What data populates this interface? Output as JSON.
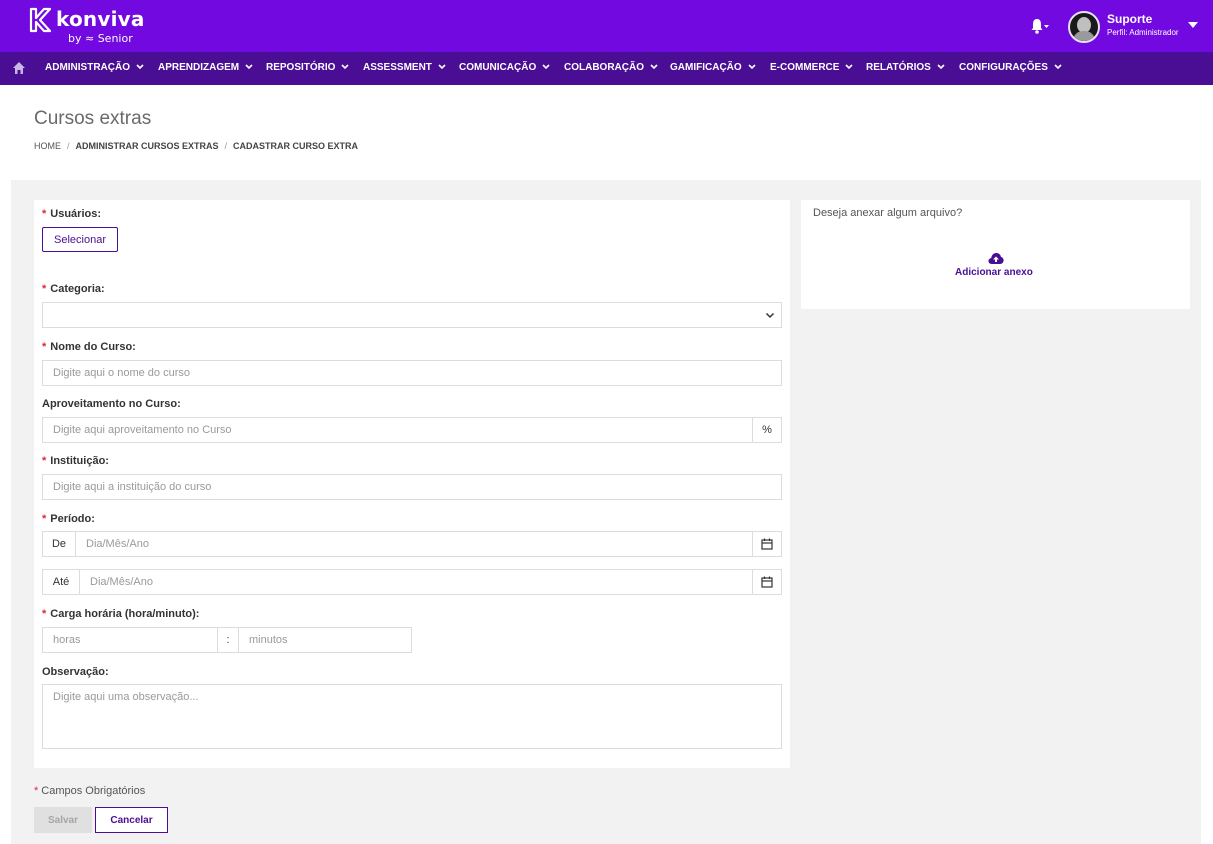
{
  "header": {
    "brand": "konviva",
    "brand_sub": "by ≈ Senior",
    "user_name": "Suporte",
    "user_role": "Perfil: Administrador"
  },
  "nav": {
    "items": [
      {
        "label": "ADMINISTRAÇÃO"
      },
      {
        "label": "APRENDIZAGEM"
      },
      {
        "label": "REPOSITÓRIO"
      },
      {
        "label": "ASSESSMENT"
      },
      {
        "label": "COMUNICAÇÃO"
      },
      {
        "label": "COLABORAÇÃO"
      },
      {
        "label": "GAMIFICAÇÃO"
      },
      {
        "label": "E-COMMERCE"
      },
      {
        "label": "RELATÓRIOS"
      },
      {
        "label": "CONFIGURAÇÕES"
      }
    ]
  },
  "page": {
    "title": "Cursos extras",
    "breadcrumb": [
      "HOME",
      "ADMINISTRAR CURSOS EXTRAS",
      "CADASTRAR CURSO EXTRA"
    ]
  },
  "form": {
    "required_mark": "*",
    "usuarios_label": "Usuários:",
    "select_button": "Selecionar",
    "categoria_label": "Categoria:",
    "categoria_value": "",
    "nome_label": "Nome do Curso:",
    "nome_placeholder": "Digite aqui o nome do curso",
    "aproveitamento_label": "Aproveitamento no Curso:",
    "aproveitamento_placeholder": "Digite aqui aproveitamento no Curso",
    "percent_addon": "%",
    "instituicao_label": "Instituição:",
    "instituicao_placeholder": "Digite aqui a instituição do curso",
    "periodo_label": "Período:",
    "de_addon": "De",
    "ate_addon": "Até",
    "date_placeholder": "Dia/Mês/Ano",
    "carga_label": "Carga horária (hora/minuto):",
    "horas_placeholder": "horas",
    "colon_addon": ":",
    "minutos_placeholder": "minutos",
    "observacao_label": "Observação:",
    "observacao_placeholder": "Digite aqui uma observação..."
  },
  "attach": {
    "question": "Deseja anexar algum arquivo?",
    "link": "Adicionar anexo"
  },
  "footer": {
    "required_note": "Campos Obrigatórios",
    "save": "Salvar",
    "cancel": "Cancelar"
  },
  "colors": {
    "header": "#7209e0",
    "nav": "#4a0e94",
    "required": "#d9263f"
  }
}
